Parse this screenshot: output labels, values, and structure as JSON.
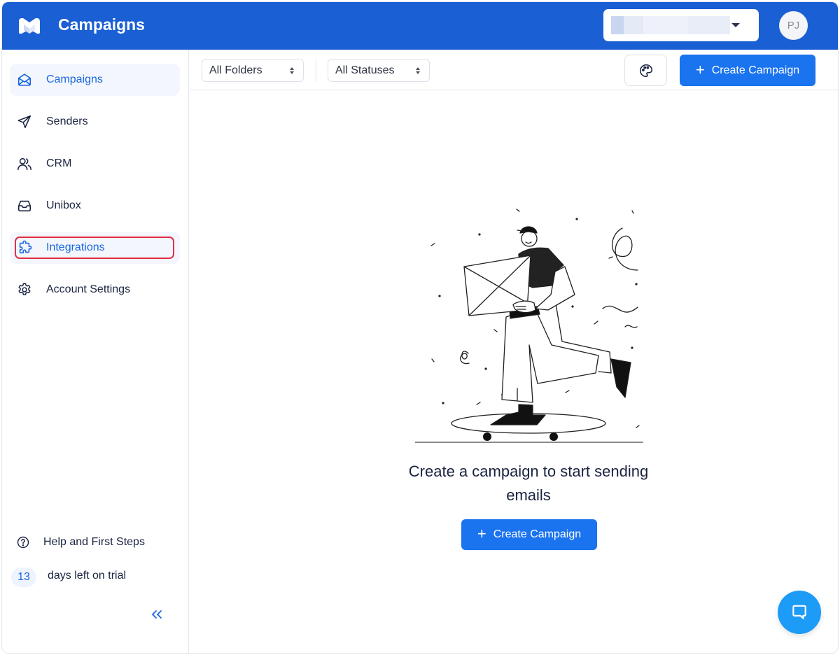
{
  "header": {
    "app_title": "Campaigns",
    "logo_icon": "brand-m-logo",
    "workspace_select": {
      "value": "",
      "caret_icon": "caret-down"
    },
    "avatar_initials": "PJ"
  },
  "sidebar": {
    "items": [
      {
        "label": "Campaigns",
        "icon": "envelope-open-icon",
        "active": true
      },
      {
        "label": "Senders",
        "icon": "paper-plane-icon",
        "active": false
      },
      {
        "label": "CRM",
        "icon": "users-icon",
        "active": false
      },
      {
        "label": "Unibox",
        "icon": "inbox-icon",
        "active": false
      },
      {
        "label": "Integrations",
        "icon": "puzzle-icon",
        "active": false,
        "highlighted": true
      },
      {
        "label": "Account Settings",
        "icon": "gear-icon",
        "active": false
      }
    ],
    "help": {
      "label": "Help and First Steps",
      "icon": "question-circle-icon"
    },
    "trial": {
      "days": "13",
      "label": "days left on trial"
    },
    "collapse_label": "«",
    "collapse_icon": "chevrons-left-icon"
  },
  "toolbar": {
    "folder_select": {
      "value": "All Folders"
    },
    "status_select": {
      "value": "All Statuses"
    },
    "palette_icon": "palette-icon",
    "create_button": {
      "label": "Create Campaign",
      "icon": "+"
    }
  },
  "main": {
    "empty_state": {
      "illustration": "person-on-skateboard-with-envelope",
      "title": "Create a campaign to start sending emails",
      "button": {
        "label": "Create Campaign",
        "icon": "+"
      }
    }
  },
  "chat": {
    "icon": "chat-bubble-icon"
  },
  "colors": {
    "header_bg": "#1a5fd4",
    "primary": "#1a73ef",
    "active_text": "#1a66e0",
    "active_bg": "#f3f7fd",
    "focus_ring": "#e12f43",
    "chat_fab": "#1c9bf7"
  }
}
